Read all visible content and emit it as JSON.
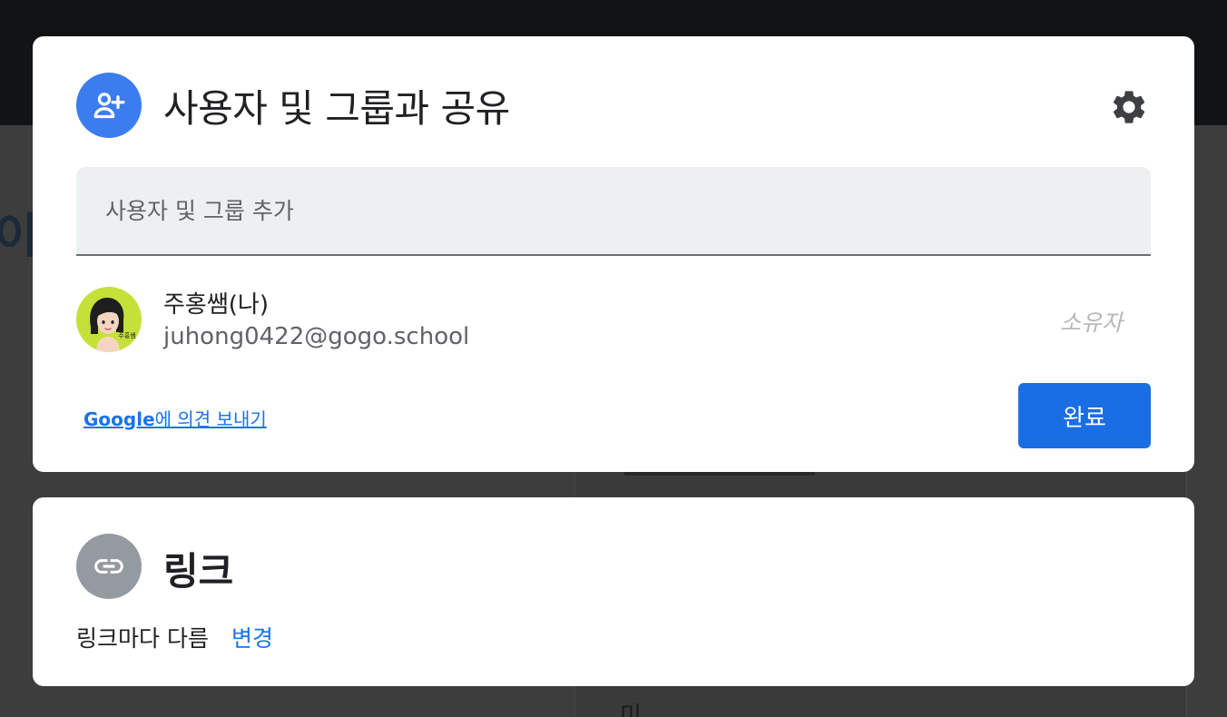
{
  "share_dialog": {
    "title": "사용자 및 그룹과 공유",
    "header_icon": "person-add-icon",
    "settings_icon": "gear-icon",
    "add_input": {
      "placeholder": "사용자 및 그룹 추가",
      "value": ""
    },
    "members": [
      {
        "name": "주홍쌤(나)",
        "email": "juhong0422@gogo.school",
        "role": "소유자",
        "avatar_caption": "주홍쌤",
        "avatar_color": "#c6e03a"
      }
    ],
    "feedback": {
      "brand": "Google",
      "text": "에 의견 보내기"
    },
    "done_label": "완료"
  },
  "link_dialog": {
    "title": "링크",
    "header_icon": "link-icon",
    "status": "링크마다 다름",
    "change_label": "변경"
  },
  "background": {
    "glyph": "이",
    "text": "미"
  },
  "colors": {
    "accent": "#1a73e8",
    "done_button": "#1a6ee3",
    "share_icon_bg": "#3b7cef",
    "link_icon_bg": "#949aa0"
  }
}
